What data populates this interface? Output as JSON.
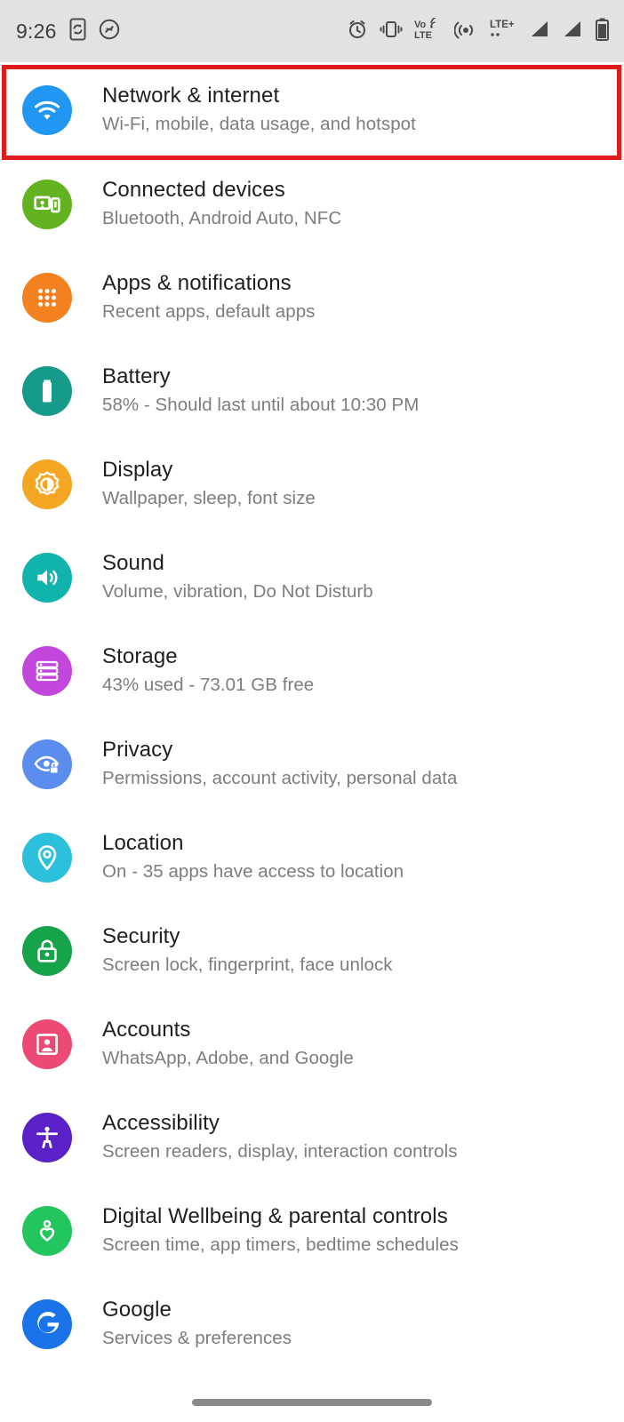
{
  "status_bar": {
    "time": "9:26",
    "left_icons": [
      {
        "name": "phone-sync-icon",
        "label": "Phone sync"
      },
      {
        "name": "shazam-icon",
        "label": "Shazam"
      }
    ],
    "right_icons": [
      {
        "name": "alarm-icon",
        "label": "Alarm set"
      },
      {
        "name": "vibrate-icon",
        "label": "Vibrate mode"
      },
      {
        "name": "volte-icon",
        "label": "VoLTE"
      },
      {
        "name": "hotspot-icon",
        "label": "Hotspot"
      },
      {
        "name": "lte-plus-icon",
        "label": "LTE+"
      },
      {
        "name": "signal-bars-sim1-icon",
        "label": "Signal SIM 1"
      },
      {
        "name": "signal-bars-sim2-icon",
        "label": "Signal SIM 2"
      },
      {
        "name": "battery-icon",
        "label": "Battery"
      }
    ],
    "volte_top": "Vo",
    "volte_bottom": "LTE",
    "lte_label": "LTE+",
    "background": "#e2e2e2"
  },
  "highlight": {
    "color": "#e01b1b",
    "target": "Network & internet"
  },
  "settings": {
    "items": [
      {
        "title": "Network & internet",
        "subtitle": "Wi-Fi, mobile, data usage, and hotspot",
        "icon": "wifi-icon",
        "color": "#2196f3",
        "key": "network-internet"
      },
      {
        "title": "Connected devices",
        "subtitle": "Bluetooth, Android Auto, NFC",
        "icon": "devices-icon",
        "color": "#63b321",
        "key": "connected-devices"
      },
      {
        "title": "Apps & notifications",
        "subtitle": "Recent apps, default apps",
        "icon": "apps-grid-icon",
        "color": "#f4811f",
        "key": "apps-notifications"
      },
      {
        "title": "Battery",
        "subtitle": "58% - Should last until about 10:30 PM",
        "icon": "battery-icon",
        "color": "#169b8b",
        "key": "battery"
      },
      {
        "title": "Display",
        "subtitle": "Wallpaper, sleep, font size",
        "icon": "brightness-icon",
        "color": "#f5a623",
        "key": "display"
      },
      {
        "title": "Sound",
        "subtitle": "Volume, vibration, Do Not Disturb",
        "icon": "volume-icon",
        "color": "#10b4ad",
        "key": "sound"
      },
      {
        "title": "Storage",
        "subtitle": "43% used - 73.01 GB free",
        "icon": "storage-icon",
        "color": "#c346dd",
        "key": "storage"
      },
      {
        "title": "Privacy",
        "subtitle": "Permissions, account activity, personal data",
        "icon": "privacy-eye-lock-icon",
        "color": "#5b8def",
        "key": "privacy"
      },
      {
        "title": "Location",
        "subtitle": "On - 35 apps have access to location",
        "icon": "location-pin-icon",
        "color": "#2dc0dd",
        "key": "location"
      },
      {
        "title": "Security",
        "subtitle": "Screen lock, fingerprint, face unlock",
        "icon": "lock-icon",
        "color": "#16a34a",
        "key": "security"
      },
      {
        "title": "Accounts",
        "subtitle": "WhatsApp, Adobe, and Google",
        "icon": "account-card-icon",
        "color": "#ec4975",
        "key": "accounts"
      },
      {
        "title": "Accessibility",
        "subtitle": "Screen readers, display, interaction controls",
        "icon": "accessibility-icon",
        "color": "#5b21c9",
        "key": "accessibility"
      },
      {
        "title": "Digital Wellbeing & parental controls",
        "subtitle": "Screen time, app timers, bedtime schedules",
        "icon": "wellbeing-heart-icon",
        "color": "#22c55e",
        "key": "digital-wellbeing"
      },
      {
        "title": "Google",
        "subtitle": "Services & preferences",
        "icon": "google-g-icon",
        "color": "#1a73e8",
        "key": "google"
      }
    ]
  },
  "navigation": {
    "gesture_bar": "home-gesture-bar"
  }
}
